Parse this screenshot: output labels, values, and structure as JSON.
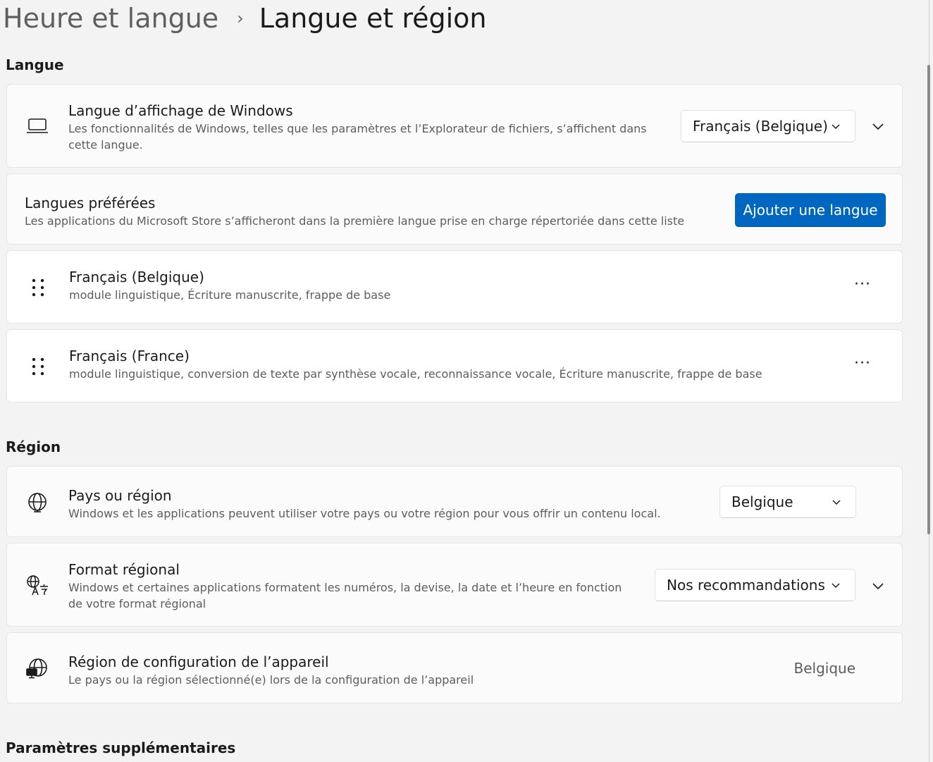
{
  "breadcrumb": {
    "parent": "Heure et langue",
    "separator": "›",
    "current": "Langue et région"
  },
  "sections": {
    "langue": "Langue",
    "region": "Région",
    "extra": "Paramètres supplémentaires"
  },
  "display_language": {
    "icon": "laptop-icon",
    "title": "Langue d’affichage de Windows",
    "subtitle_line1": "Les fonctionnalités de Windows, telles que les paramètres et l’Explorateur de fichiers, s’affichent dans",
    "subtitle_line2": "cette langue.",
    "selected": "Français (Belgique)"
  },
  "preferred_languages": {
    "title": "Langues préférées",
    "subtitle": "Les applications du Microsoft Store s’afficheront dans la première langue prise en charge répertoriée dans cette liste",
    "add_button": "Ajouter une langue",
    "items": [
      {
        "name": "Français (Belgique)",
        "features": "module linguistique, Écriture manuscrite, frappe de base",
        "more": "···"
      },
      {
        "name": "Français (France)",
        "features": "module linguistique, conversion de texte par synthèse vocale, reconnaissance vocale, Écriture manuscrite, frappe de base",
        "more": "···"
      }
    ]
  },
  "country": {
    "icon": "globe-icon",
    "title": "Pays ou région",
    "subtitle": "Windows et les applications peuvent utiliser votre pays ou votre région pour vous offrir un contenu local.",
    "selected": "Belgique"
  },
  "regional_format": {
    "icon": "language-translate-icon",
    "title": "Format régional",
    "subtitle_line1": "Windows et certaines applications formatent les numéros, la devise, la date et l’heure en fonction",
    "subtitle_line2": "de votre format régional",
    "selected": "Nos recommandations"
  },
  "device_region": {
    "icon": "globe-device-icon",
    "title": "Région de configuration de l’appareil",
    "subtitle": "Le pays ou la région sélectionné(e) lors de la configuration de l’appareil",
    "value": "Belgique"
  },
  "colors": {
    "accent": "#0067c0",
    "background": "#f3f3f3",
    "card": "#fbfbfb"
  }
}
